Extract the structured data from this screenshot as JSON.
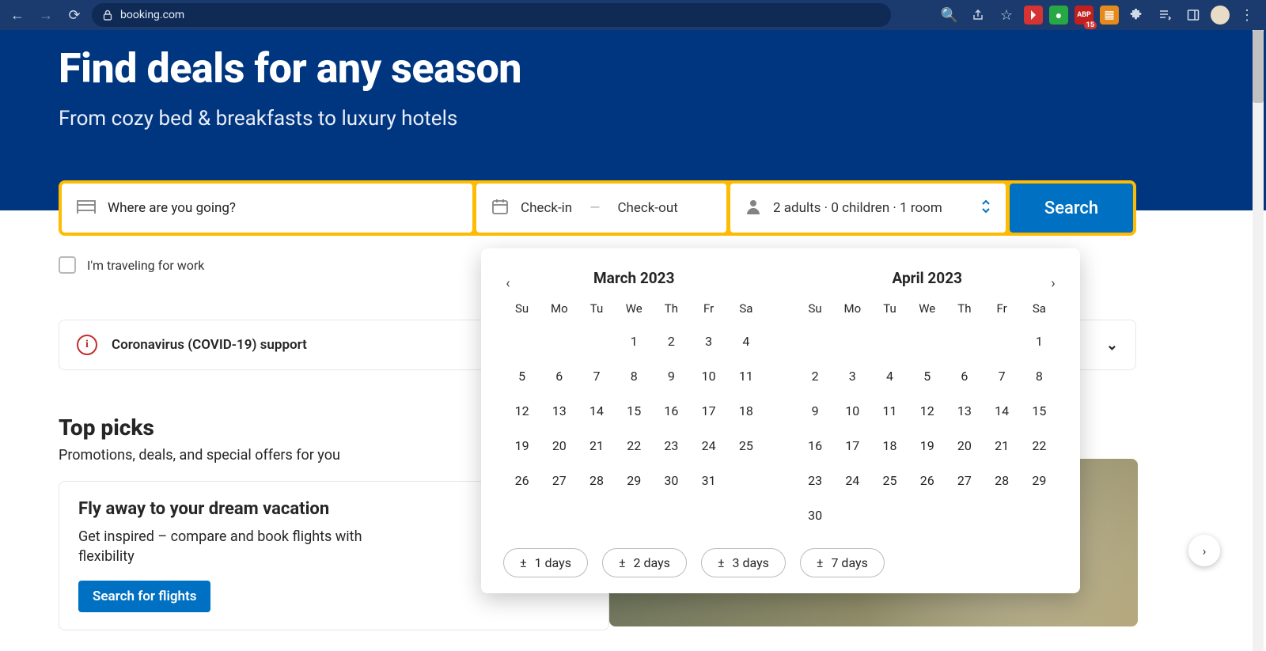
{
  "browser": {
    "url": "booking.com",
    "ext_badge": "15",
    "ext_abp": "ABP"
  },
  "hero": {
    "title": "Find deals for any season",
    "subtitle": "From cozy bed & breakfasts to luxury hotels"
  },
  "search": {
    "destination_placeholder": "Where are you going?",
    "checkin_label": "Check-in",
    "checkout_label": "Check-out",
    "occupancy": "2 adults  ·  0 children  ·  1 room",
    "button": "Search"
  },
  "travel_for_work": "I'm traveling for work",
  "covid": "Coronavirus (COVID-19) support",
  "top_picks": {
    "heading": "Top picks",
    "sub": "Promotions, deals, and special offers for you"
  },
  "promo": {
    "title": "Fly away to your dream vacation",
    "body": "Get inspired – compare and book flights with flexibility",
    "cta": "Search for flights"
  },
  "datepicker": {
    "weekdays": [
      "Su",
      "Mo",
      "Tu",
      "We",
      "Th",
      "Fr",
      "Sa"
    ],
    "month1": {
      "title": "March 2023",
      "grid": [
        [
          "",
          "",
          "",
          "1",
          "2",
          "3",
          "4"
        ],
        [
          "5",
          "6",
          "7",
          "8",
          "9",
          "10",
          "11"
        ],
        [
          "12",
          "13",
          "14",
          "15",
          "16",
          "17",
          "18"
        ],
        [
          "19",
          "20",
          "21",
          "22",
          "23",
          "24",
          "25"
        ],
        [
          "26",
          "27",
          "28",
          "29",
          "30",
          "31",
          ""
        ],
        [
          "",
          "",
          "",
          "",
          "",
          "",
          ""
        ]
      ]
    },
    "month2": {
      "title": "April 2023",
      "grid": [
        [
          "",
          "",
          "",
          "",
          "",
          "",
          "1"
        ],
        [
          "2",
          "3",
          "4",
          "5",
          "6",
          "7",
          "8"
        ],
        [
          "9",
          "10",
          "11",
          "12",
          "13",
          "14",
          "15"
        ],
        [
          "16",
          "17",
          "18",
          "19",
          "20",
          "21",
          "22"
        ],
        [
          "23",
          "24",
          "25",
          "26",
          "27",
          "28",
          "29"
        ],
        [
          "30",
          "",
          "",
          "",
          "",
          "",
          ""
        ]
      ]
    },
    "flex": [
      "1 days",
      "2 days",
      "3 days",
      "7 days"
    ]
  }
}
